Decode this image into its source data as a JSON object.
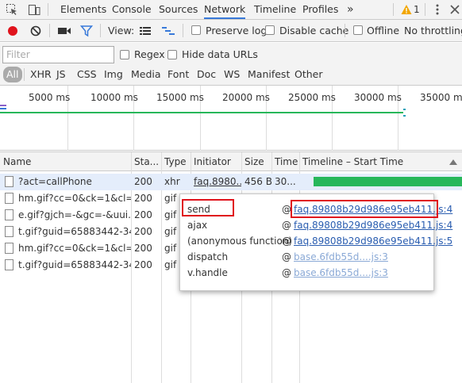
{
  "tabs": [
    "Elements",
    "Console",
    "Sources",
    "Network",
    "Timeline",
    "Profiles"
  ],
  "active_tab": "Network",
  "warning_count": "1",
  "toolbar": {
    "view_label": "View:",
    "preserve_log": "Preserve log",
    "disable_cache": "Disable cache",
    "offline": "Offline",
    "throttling": "No throttling"
  },
  "filter": {
    "placeholder": "Filter",
    "regex": "Regex",
    "hide_data_urls": "Hide data URLs",
    "types": [
      "All",
      "XHR",
      "JS",
      "CSS",
      "Img",
      "Media",
      "Font",
      "Doc",
      "WS",
      "Manifest",
      "Other"
    ]
  },
  "overview": {
    "ticks": [
      "5000 ms",
      "10000 ms",
      "15000 ms",
      "20000 ms",
      "25000 ms",
      "30000 ms",
      "35000 ms"
    ]
  },
  "columns": [
    "Name",
    "Sta...",
    "Type",
    "Initiator",
    "Size",
    "Time",
    "Timeline – Start Time"
  ],
  "rows": [
    {
      "name": "?act=callPhone",
      "status": "200",
      "type": "xhr",
      "initiator": "faq.8980...",
      "size": "456 B",
      "time": "30..."
    },
    {
      "name": "hm.gif?cc=0&ck=1&cl=...",
      "status": "200",
      "type": "gif",
      "initiator": "",
      "size": "",
      "time": ""
    },
    {
      "name": "e.gif?gjch=-&gc=-&uui...",
      "status": "200",
      "type": "gif",
      "initiator": "",
      "size": "",
      "time": ""
    },
    {
      "name": "t.gif?guid=65883442-34...",
      "status": "200",
      "type": "gif",
      "initiator": "",
      "size": "",
      "time": ""
    },
    {
      "name": "hm.gif?cc=0&ck=1&cl=...",
      "status": "200",
      "type": "gif",
      "initiator": "",
      "size": "",
      "time": ""
    },
    {
      "name": "t.gif?guid=65883442-34...",
      "status": "200",
      "type": "gif",
      "initiator": "",
      "size": "",
      "time": ""
    }
  ],
  "stack": [
    {
      "fn": "send",
      "at": "@",
      "link": "faq.89808b29d986e95eb411.js:4"
    },
    {
      "fn": "ajax",
      "at": "@",
      "link": "faq.89808b29d986e95eb411.js:4"
    },
    {
      "fn": "(anonymous function)",
      "at": "@",
      "link": "faq.89808b29d986e95eb411.js:5"
    },
    {
      "fn": "dispatch",
      "at": "@",
      "link": "base.6fdb55d....js:3"
    },
    {
      "fn": "v.handle",
      "at": "@",
      "link": "base.6fdb55d....js:3"
    }
  ],
  "colors": {
    "accent": "#3879d9",
    "record": "#e0131c",
    "waterfall": "#27b75a",
    "highlight": "#e0131c"
  }
}
